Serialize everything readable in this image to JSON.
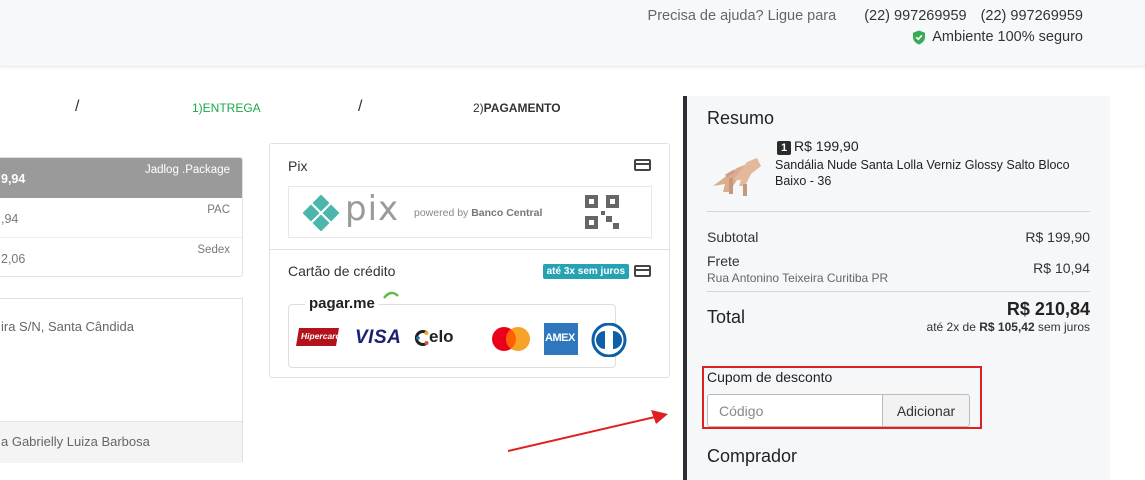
{
  "header": {
    "help_text": "Precisa de ajuda? Ligue para",
    "phone_1": "(22) 997269959",
    "phone_2": "(22) 997269959",
    "secure_text": "Ambiente 100% seguro",
    "secure_icon": "shield-check-icon",
    "secure_color": "#3aaa55"
  },
  "steps": [
    {
      "num": "1)",
      "label": "ENTREGA",
      "active": true
    },
    {
      "num": "2)",
      "label": "PAGAMENTO",
      "active": false
    }
  ],
  "shipping": {
    "options": [
      {
        "price": "9,94",
        "name": "Jadlog .Package",
        "selected": true
      },
      {
        "price": ",94",
        "name": "PAC",
        "selected": false
      },
      {
        "price": "2,06",
        "name": "Sedex",
        "selected": false
      }
    ]
  },
  "address": {
    "line": "ira S/N, Santa Cândida",
    "recipient": "a Gabrielly Luiza Barbosa"
  },
  "payment": {
    "pix_label": "Pix",
    "pix_logo_text": "pix",
    "pix_powered": "powered by",
    "pix_bank": "Banco Central",
    "card_label": "Cartão de crédito",
    "badge": "até 3x sem juros",
    "gateway": "pagar.me",
    "brands": [
      "Hipercard",
      "VISA",
      "elo",
      "mastercard",
      "AMEX",
      "Diners"
    ],
    "accent": "#27a2b5"
  },
  "summary": {
    "title": "Resumo",
    "qty": "1",
    "product_price": "R$ 199,90",
    "product_name": "Sandália Nude Santa Lolla Verniz Glossy Salto Bloco Baixo - 36",
    "subtotal_label": "Subtotal",
    "subtotal_value": "R$ 199,90",
    "frete_label": "Frete",
    "frete_address": "Rua Antonino Teixeira Curitiba PR",
    "frete_value": "R$ 10,94",
    "total_label": "Total",
    "total_value": "R$ 210,84",
    "inst_prefix": "até 2x de",
    "inst_value": "R$ 105,42",
    "inst_suffix": "sem juros",
    "coupon_label": "Cupom de desconto",
    "coupon_placeholder": "Código",
    "coupon_button": "Adicionar",
    "buyer_title": "Comprador"
  },
  "annotation_color": "#e02020"
}
